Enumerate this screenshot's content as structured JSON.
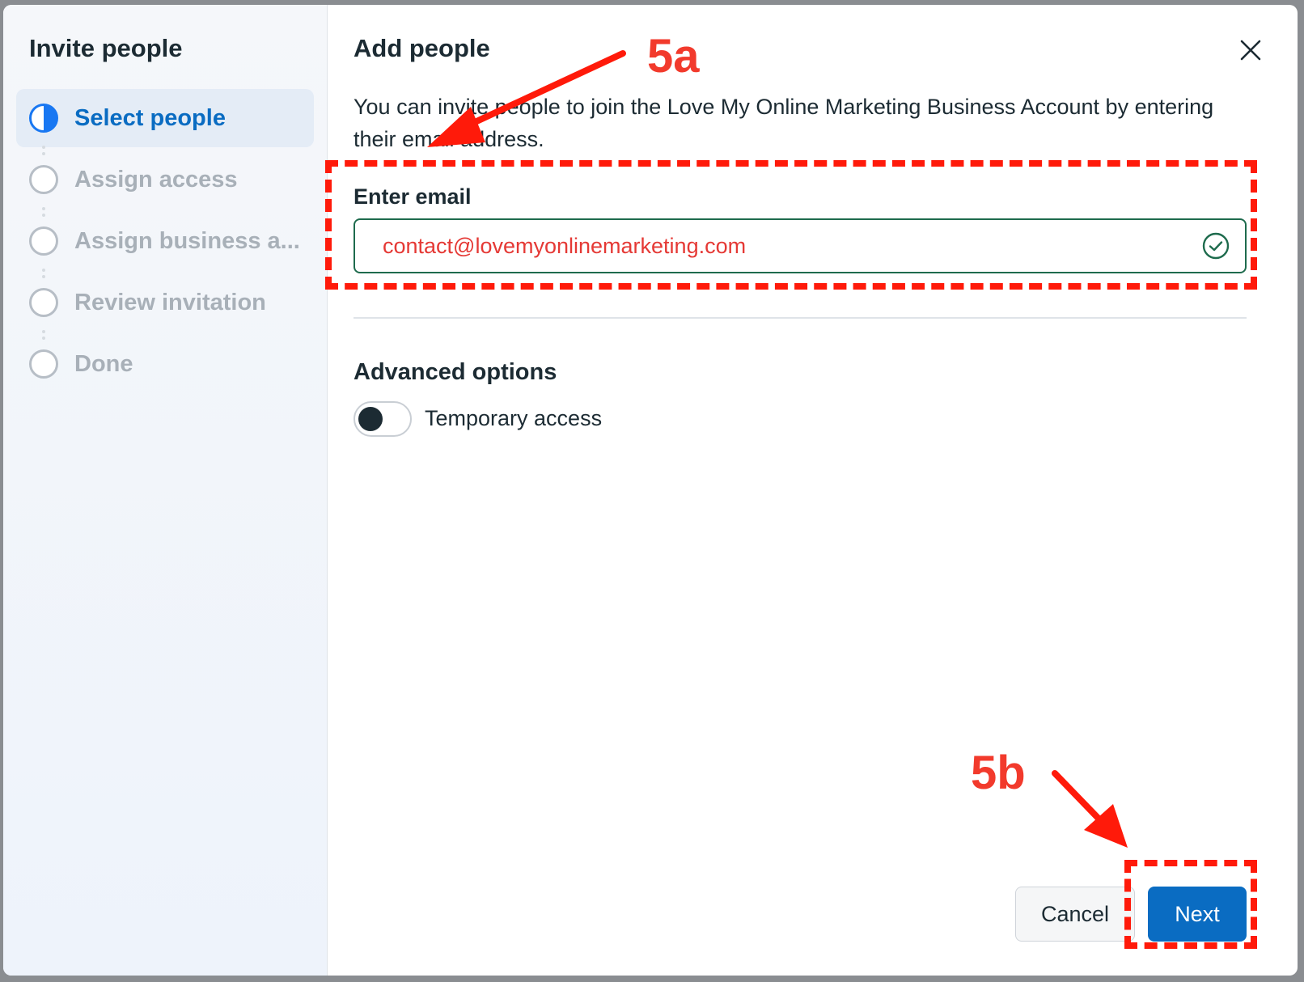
{
  "sidebar": {
    "title": "Invite people",
    "steps": [
      {
        "label": "Select people",
        "state": "active"
      },
      {
        "label": "Assign access",
        "state": "pending"
      },
      {
        "label": "Assign business a...",
        "state": "pending"
      },
      {
        "label": "Review invitation",
        "state": "pending"
      },
      {
        "label": "Done",
        "state": "pending"
      }
    ]
  },
  "main": {
    "title": "Add people",
    "description": "You can invite people to join the Love My Online Marketing Business Account by entering their email address.",
    "email_label": "Enter email",
    "email_value": "contact@lovemyonlinemarketing.com",
    "advanced_title": "Advanced options",
    "toggle_label": "Temporary access",
    "toggle_on": false
  },
  "footer": {
    "cancel_label": "Cancel",
    "next_label": "Next"
  },
  "annotations": {
    "label_a": "5a",
    "label_b": "5b",
    "color": "#ff1a0a"
  },
  "icons": {
    "close": "close-icon",
    "valid": "check-circle-icon"
  }
}
